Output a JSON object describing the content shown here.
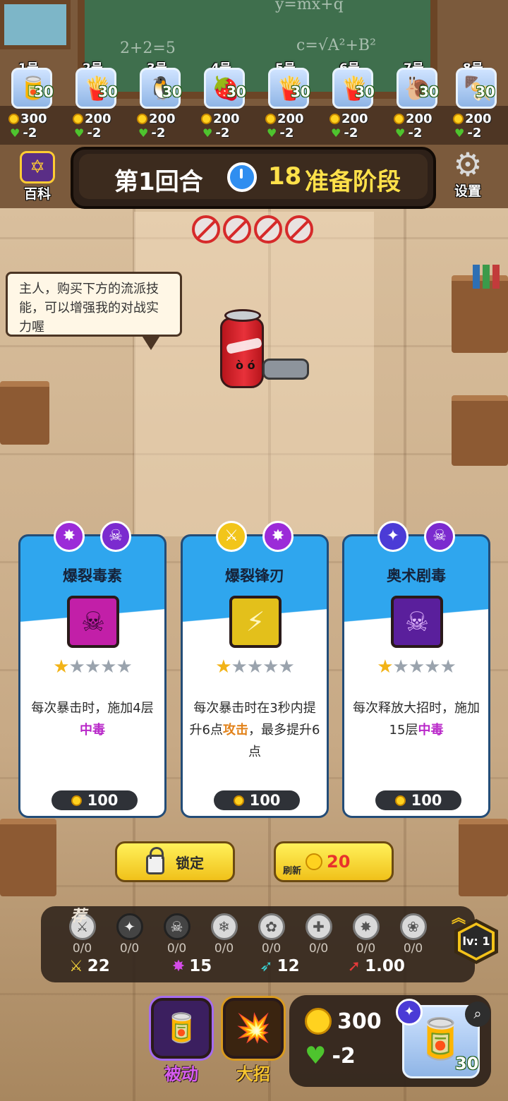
{
  "roster": [
    {
      "num": "1号",
      "glyph": "🥫",
      "hp": "30",
      "coins": "300",
      "hearts": "-2"
    },
    {
      "num": "2号",
      "glyph": "🍟",
      "hp": "30",
      "coins": "200",
      "hearts": "-2"
    },
    {
      "num": "3号",
      "glyph": "🐧",
      "hp": "30",
      "coins": "200",
      "hearts": "-2"
    },
    {
      "num": "4号",
      "glyph": "🍓",
      "hp": "30",
      "coins": "200",
      "hearts": "-2"
    },
    {
      "num": "5号",
      "glyph": "🍟",
      "hp": "30",
      "coins": "200",
      "hearts": "-2"
    },
    {
      "num": "6号",
      "glyph": "🍟",
      "hp": "30",
      "coins": "200",
      "hearts": "-2"
    },
    {
      "num": "7号",
      "glyph": "🐌",
      "hp": "30",
      "coins": "200",
      "hearts": "-2"
    },
    {
      "num": "8号",
      "glyph": "🍢",
      "hp": "30",
      "coins": "200",
      "hearts": "-2"
    }
  ],
  "header": {
    "round": "第1回合",
    "timer": "18",
    "phase": "准备阶段",
    "encyclopedia_label": "百科",
    "settings_label": "设置"
  },
  "bubble": {
    "text": "主人，购买下方的流派技能，可以增强我的对战实力喔"
  },
  "cards": [
    {
      "title": "爆裂毒素",
      "tags": [
        "burst-icon",
        "poison-skull-icon"
      ],
      "icon": "burst-poison-icon",
      "stars": 1,
      "desc_a": "每次暴击时，施加4层",
      "desc_hl": "中毒",
      "desc_b": "",
      "price": "100"
    },
    {
      "title": "爆裂锋刃",
      "tags": [
        "blade-icon",
        "burst-icon"
      ],
      "icon": "burst-blade-icon",
      "stars": 1,
      "desc_a": "每次暴击时在3秒内提升6点",
      "desc_hl": "攻击",
      "desc_b": "，最多提升6点",
      "price": "100"
    },
    {
      "title": "奥术剧毒",
      "tags": [
        "arcane-icon",
        "poison-skull-icon"
      ],
      "icon": "crossbones-icon",
      "stars": 1,
      "desc_a": "每次释放大招时，施加15层",
      "desc_hl": "中毒",
      "desc_b": "",
      "price": "100"
    }
  ],
  "actions": {
    "lock_label": "锁定",
    "refresh_label": "刷新",
    "refresh_cost": "20"
  },
  "traits": {
    "recommend": "荐",
    "items": [
      {
        "icon": "sword-trait-icon",
        "glyph": "⚔",
        "count": "0/0"
      },
      {
        "icon": "arcane-trait-icon",
        "glyph": "✦",
        "count": "0/0"
      },
      {
        "icon": "skull-trait-icon",
        "glyph": "☠",
        "count": "0/0"
      },
      {
        "icon": "frost-trait-icon",
        "glyph": "❄",
        "count": "0/0"
      },
      {
        "icon": "nature-trait-icon",
        "glyph": "✿",
        "count": "0/0"
      },
      {
        "icon": "heal-trait-icon",
        "glyph": "✚",
        "count": "0/0"
      },
      {
        "icon": "burst-trait-icon",
        "glyph": "✸",
        "count": "0/0"
      },
      {
        "icon": "paw-trait-icon",
        "glyph": "❀",
        "count": "0/0"
      }
    ],
    "stats": {
      "attack": "22",
      "crit": "15",
      "speed": "12",
      "rate": "1.00"
    },
    "level": "lv: 1"
  },
  "bottom": {
    "passive_label": "被动",
    "ult_label": "大招",
    "coins": "300",
    "hearts": "-2",
    "hp": "30"
  },
  "colors": {
    "poison": "#b928c9",
    "attack": "#e2821a",
    "gold": "#f3c21a",
    "card_blue": "#2fa6ee"
  }
}
